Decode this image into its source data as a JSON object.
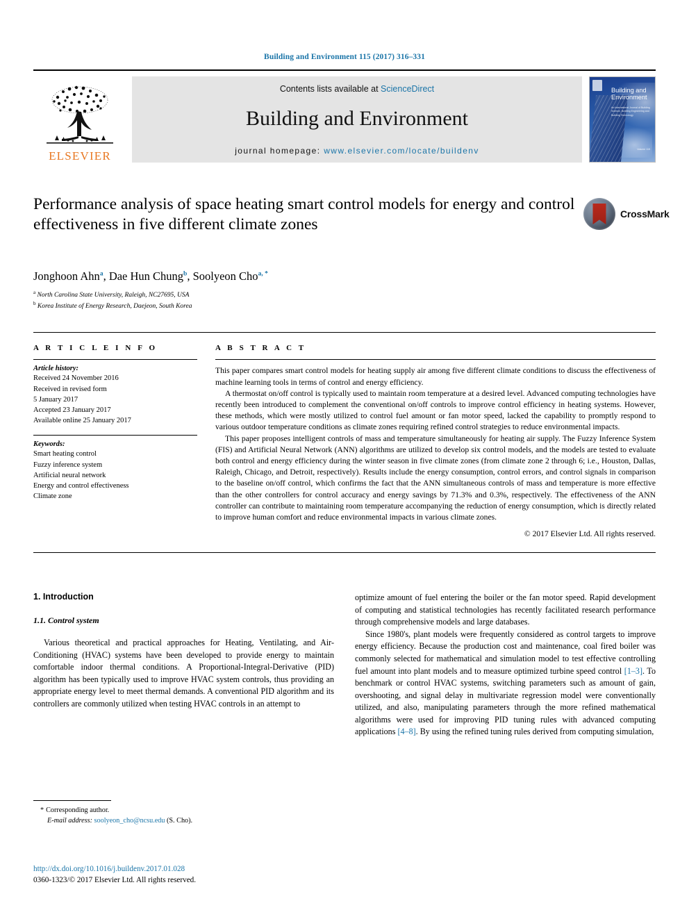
{
  "running_head": "Building and Environment 115 (2017) 316–331",
  "masthead": {
    "publisher_name": "ELSEVIER",
    "contents_prefix": "Contents lists available at",
    "contents_link": "ScienceDirect",
    "journal_title": "Building and Environment",
    "homepage_prefix": "journal homepage:",
    "homepage_url": "www.elsevier.com/locate/buildenv",
    "cover": {
      "title_line1": "Building and",
      "title_line2": "Environment",
      "subtitle": "An International Journal of Building Science, Building Engineering and Building Technology",
      "volume_note": "Volume 115"
    }
  },
  "article": {
    "title": "Performance analysis of space heating smart control models for energy and control effectiveness in five different climate zones",
    "crossmark_label": "CrossMark",
    "authors": [
      {
        "name": "Jonghoon Ahn",
        "marks": "a"
      },
      {
        "name": "Dae Hun Chung",
        "marks": "b"
      },
      {
        "name": "Soolyeon Cho",
        "marks": "a, *"
      }
    ],
    "affiliations": [
      {
        "mark": "a",
        "text": "North Carolina State University, Raleigh, NC27695, USA"
      },
      {
        "mark": "b",
        "text": "Korea Institute of Energy Research, Daejeon, South Korea"
      }
    ]
  },
  "article_info": {
    "heading": "A R T I C L E  I N F O",
    "history_label": "Article history:",
    "history": [
      "Received 24 November 2016",
      "Received in revised form",
      "5 January 2017",
      "Accepted 23 January 2017",
      "Available online 25 January 2017"
    ],
    "keywords_label": "Keywords:",
    "keywords": [
      "Smart heating control",
      "Fuzzy inference system",
      "Artificial neural network",
      "Energy and control effectiveness",
      "Climate zone"
    ]
  },
  "abstract": {
    "heading": "A B S T R A C T",
    "paragraphs": [
      "This paper compares smart control models for heating supply air among five different climate conditions to discuss the effectiveness of machine learning tools in terms of control and energy efficiency.",
      "A thermostat on/off control is typically used to maintain room temperature at a desired level. Advanced computing technologies have recently been introduced to complement the conventional on/off controls to improve control efficiency in heating systems. However, these methods, which were mostly utilized to control fuel amount or fan motor speed, lacked the capability to promptly respond to various outdoor temperature conditions as climate zones requiring refined control strategies to reduce environmental impacts.",
      "This paper proposes intelligent controls of mass and temperature simultaneously for heating air supply. The Fuzzy Inference System (FIS) and Artificial Neural Network (ANN) algorithms are utilized to develop six control models, and the models are tested to evaluate both control and energy efficiency during the winter season in five climate zones (from climate zone 2 through 6; i.e., Houston, Dallas, Raleigh, Chicago, and Detroit, respectively). Results include the energy consumption, control errors, and control signals in comparison to the baseline on/off control, which confirms the fact that the ANN simultaneous controls of mass and temperature is more effective than the other controllers for control accuracy and energy savings by 71.3% and 0.3%, respectively. The effectiveness of the ANN controller can contribute to maintaining room temperature accompanying the reduction of energy consumption, which is directly related to improve human comfort and reduce environmental impacts in various climate zones."
    ],
    "copyright": "© 2017 Elsevier Ltd. All rights reserved."
  },
  "body": {
    "section_number_title": "1.  Introduction",
    "subsection_number_title": "1.1.  Control system",
    "left_paragraphs": [
      "Various theoretical and practical approaches for Heating, Ventilating, and Air-Conditioning (HVAC) systems have been developed to provide energy to maintain comfortable indoor thermal conditions. A Proportional-Integral-Derivative (PID) algorithm has been typically used to improve HVAC system controls, thus providing an appropriate energy level to meet thermal demands. A conventional PID algorithm and its controllers are commonly utilized when testing HVAC controls in an attempt to"
    ],
    "right_paragraphs": [
      {
        "indent": false,
        "parts": [
          {
            "type": "text",
            "text": "optimize amount of fuel entering the boiler or the fan motor speed. Rapid development of computing and statistical technologies has recently facilitated research performance through comprehensive models and large databases."
          }
        ]
      },
      {
        "indent": true,
        "parts": [
          {
            "type": "text",
            "text": "Since 1980's, plant models were frequently considered as control targets to improve energy efficiency. Because the production cost and maintenance, coal fired boiler was commonly selected for mathematical and simulation model to test effective controlling fuel amount into plant models and to measure optimized turbine speed control "
          },
          {
            "type": "ref",
            "text": "[1–3]"
          },
          {
            "type": "text",
            "text": ". To benchmark or control HVAC systems, switching parameters such as amount of gain, overshooting, and signal delay in multivariate regression model were conventionally utilized, and also, manipulating parameters through the more refined mathematical algorithms were used for improving PID tuning rules with advanced computing applications "
          },
          {
            "type": "ref",
            "text": "[4–8]"
          },
          {
            "type": "text",
            "text": ". By using the refined tuning rules derived from computing simulation,"
          }
        ]
      }
    ]
  },
  "footnote": {
    "corresponding_marker": "*",
    "corresponding_text": "Corresponding author.",
    "email_label": "E-mail address:",
    "email": "soolyeon_cho@ncsu.edu",
    "email_suffix": "(S. Cho)."
  },
  "doi": {
    "url": "http://dx.doi.org/10.1016/j.buildenv.2017.01.028",
    "issn_line": "0360-1323/© 2017 Elsevier Ltd. All rights reserved."
  },
  "colors": {
    "link_blue": "#1b75a8",
    "elsevier_orange": "#e87722",
    "band_gray": "#e4e4e4"
  }
}
